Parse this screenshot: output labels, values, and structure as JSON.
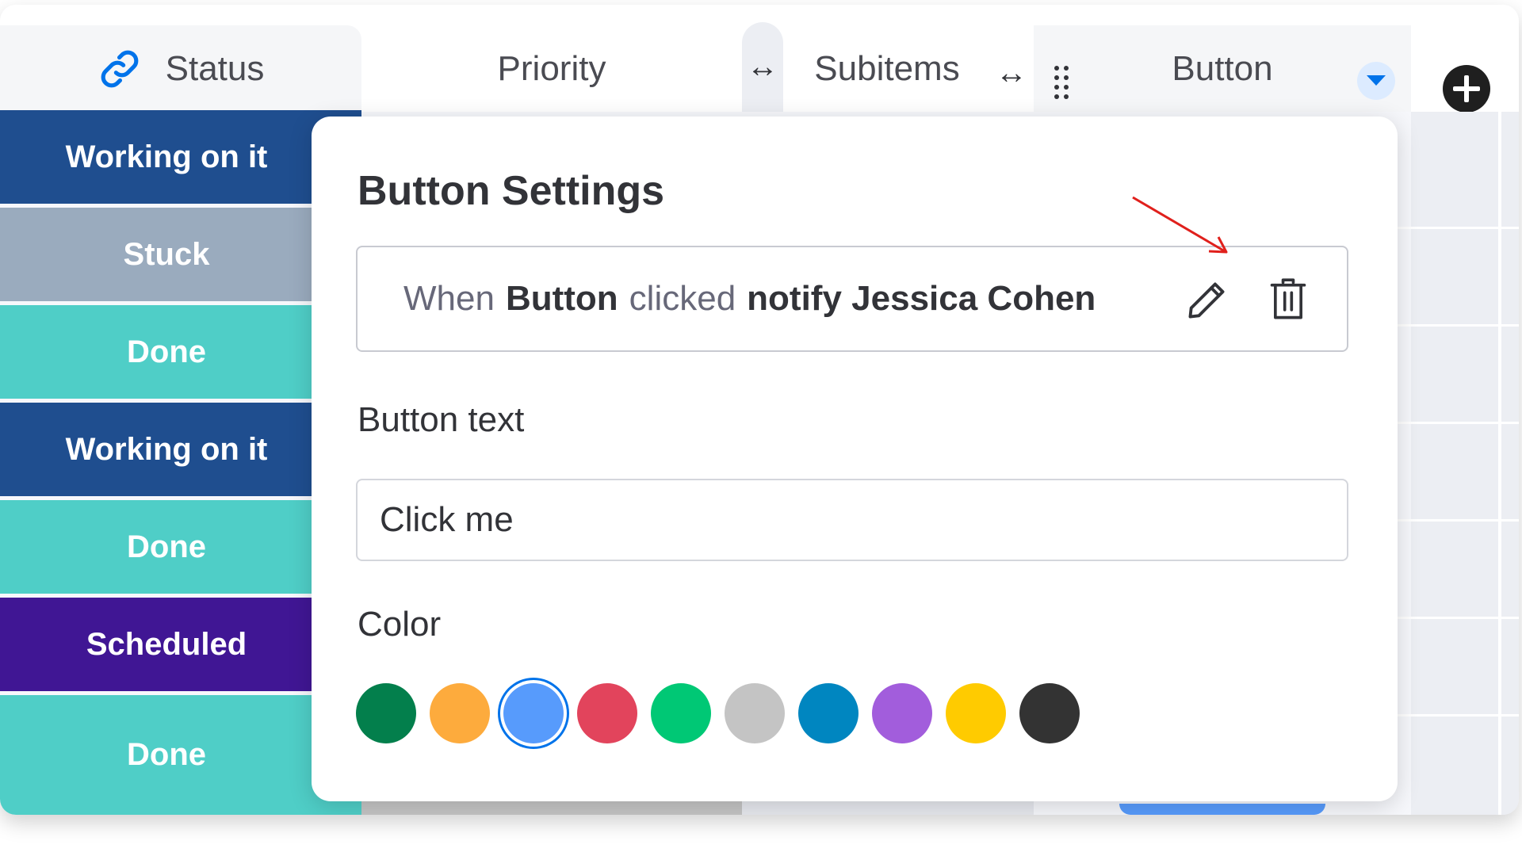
{
  "header": {
    "status_label": "Status",
    "priority_label": "Priority",
    "subitems_label": "Subitems",
    "button_label": "Button",
    "resize_glyph": "↔"
  },
  "status_cells": [
    {
      "label": "Working on it",
      "color": "#1f4e8f"
    },
    {
      "label": "Stuck",
      "color": "#9aabbe"
    },
    {
      "label": "Done",
      "color": "#4fcec7"
    },
    {
      "label": "Working on it",
      "color": "#1f4e8f"
    },
    {
      "label": "Done",
      "color": "#4fcec7"
    },
    {
      "label": "Scheduled",
      "color": "#401694"
    },
    {
      "label": "Done",
      "color": "#4fcec7"
    }
  ],
  "panel": {
    "title": "Button Settings",
    "rule": {
      "when": "When",
      "trigger": "Button",
      "clicked": "clicked",
      "action": "notify Jessica Cohen"
    },
    "button_text_label": "Button text",
    "button_text_value": "Click me",
    "color_label": "Color",
    "colors": [
      {
        "name": "green-dark",
        "hex": "#037f4c"
      },
      {
        "name": "orange",
        "hex": "#fdab3d"
      },
      {
        "name": "blue",
        "hex": "#579bfc",
        "selected": true
      },
      {
        "name": "red",
        "hex": "#e2445c"
      },
      {
        "name": "green",
        "hex": "#00c875"
      },
      {
        "name": "grey",
        "hex": "#c4c4c4"
      },
      {
        "name": "blue-dark",
        "hex": "#0086c0"
      },
      {
        "name": "purple",
        "hex": "#a25ddc"
      },
      {
        "name": "yellow",
        "hex": "#ffcb00"
      },
      {
        "name": "black",
        "hex": "#333333"
      }
    ]
  },
  "icons": {
    "status": "link-icon",
    "drag": "drag-handle-icon",
    "column_menu": "chevron-down-icon",
    "add_column": "plus-circle-icon",
    "edit": "pencil-icon",
    "delete": "trash-icon",
    "annotation": "red-arrow"
  },
  "accent_color": "#0073ea"
}
